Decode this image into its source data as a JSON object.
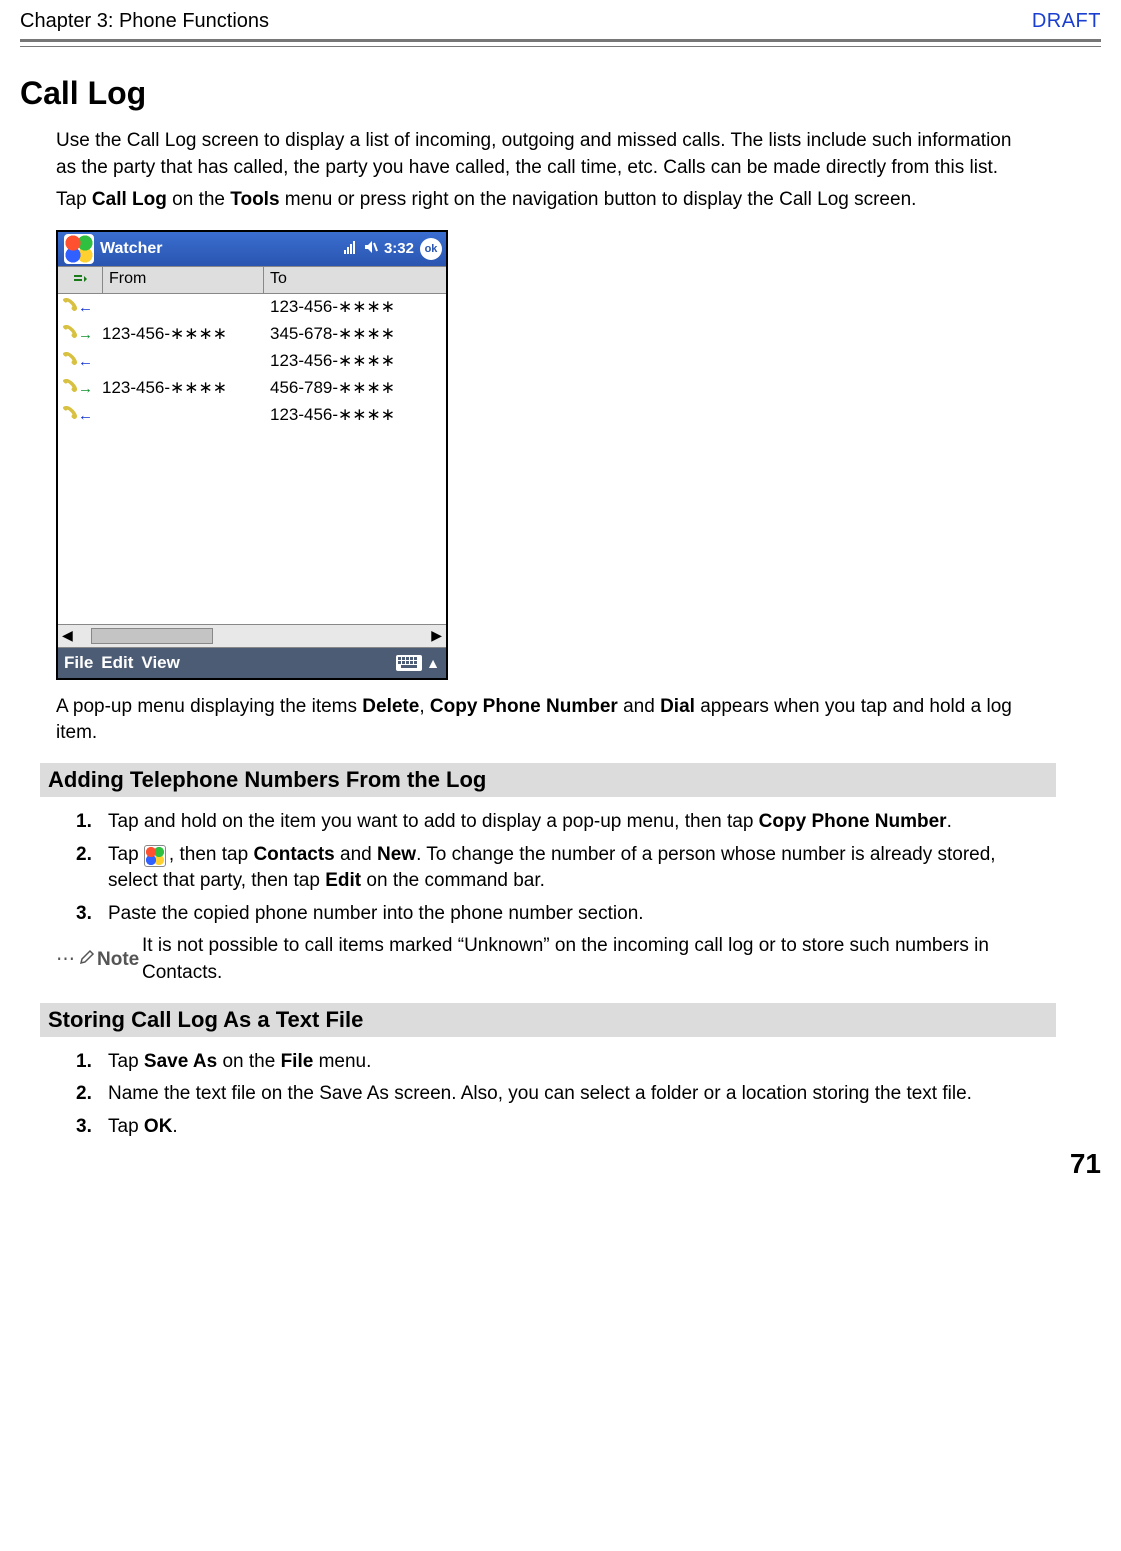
{
  "header": {
    "chapter": "Chapter 3: Phone Functions",
    "draft": "DRAFT"
  },
  "h1": "Call Log",
  "intro1": "Use the Call Log screen to display a list of incoming, outgoing and missed calls. The lists include such information as the party that has called, the party you have called, the call time, etc. Calls can be made directly from this list.",
  "intro2_pre": "Tap ",
  "intro2_b1": "Call Log",
  "intro2_mid": " on the ",
  "intro2_b2": "Tools",
  "intro2_post": " menu or press right on the navigation button to display the Call Log screen.",
  "screenshot": {
    "title": "Watcher",
    "time": "3:32",
    "ok": "ok",
    "columns": {
      "from": "From",
      "to": "To"
    },
    "rows": [
      {
        "dir": "in",
        "from": "",
        "to": "123-456-∗∗∗∗"
      },
      {
        "dir": "out",
        "from": "123-456-∗∗∗∗",
        "to": "345-678-∗∗∗∗"
      },
      {
        "dir": "in",
        "from": "",
        "to": "123-456-∗∗∗∗"
      },
      {
        "dir": "out",
        "from": "123-456-∗∗∗∗",
        "to": "456-789-∗∗∗∗"
      },
      {
        "dir": "in",
        "from": "",
        "to": "123-456-∗∗∗∗"
      }
    ],
    "menu": {
      "file": "File",
      "edit": "Edit",
      "view": "View"
    }
  },
  "popup_pre": "A pop-up menu displaying the items ",
  "popup_b1": "Delete",
  "popup_sep1": ", ",
  "popup_b2": "Copy Phone Number",
  "popup_sep2": " and ",
  "popup_b3": "Dial",
  "popup_post": " appears when you tap and hold a log item.",
  "section1": "Adding Telephone Numbers From the Log",
  "s1_steps": {
    "n1": "1.",
    "t1_pre": "Tap and hold on the item you want to add to display a pop-up menu, then tap ",
    "t1_b": "Copy Phone Number",
    "t1_post": ".",
    "n2": "2.",
    "t2_pre": "Tap ",
    "t2_mid1": ", then tap ",
    "t2_b1": "Contacts",
    "t2_mid2": " and ",
    "t2_b2": "New",
    "t2_mid3": ". To change the number of a person whose number is already stored, select that party, then tap ",
    "t2_b3": "Edit",
    "t2_post": " on the command bar.",
    "n3": "3.",
    "t3": "Paste the copied phone number into the phone number section."
  },
  "note": {
    "label": "Note",
    "text": "It is not possible to call items marked “Unknown” on the incoming call log or to store such numbers in Contacts."
  },
  "section2": "Storing Call Log As a Text File",
  "s2_steps": {
    "n1": "1.",
    "t1_pre": "Tap ",
    "t1_b1": "Save As",
    "t1_mid": " on the ",
    "t1_b2": "File",
    "t1_post": " menu.",
    "n2": "2.",
    "t2": "Name the text file on the Save As screen. Also, you can select a folder or a location storing the text file.",
    "n3": "3.",
    "t3_pre": "Tap ",
    "t3_b": "OK",
    "t3_post": "."
  },
  "page_num": "71"
}
